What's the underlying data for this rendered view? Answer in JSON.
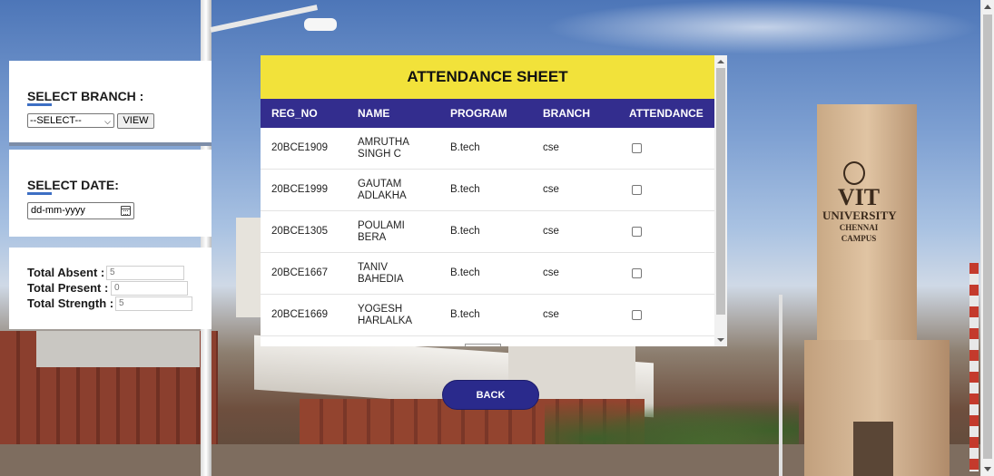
{
  "branch": {
    "heading_prefix": "SEL",
    "heading_rest": "ECT BRANCH :",
    "select_value": "--SELECT--",
    "view_label": "VIEW"
  },
  "date": {
    "heading_prefix": "SEL",
    "heading_rest": "ECT DATE:",
    "placeholder": "dd-mm-yyyy"
  },
  "totals": {
    "absent_label": "Total Absent :",
    "absent_value": "5",
    "present_label": "Total Present :",
    "present_value": "0",
    "strength_label": "Total Strength :",
    "strength_value": "5"
  },
  "sheet": {
    "title": "ATTENDANCE SHEET",
    "columns": [
      "REG_NO",
      "NAME",
      "PROGRAM",
      "BRANCH",
      "ATTENDANCE"
    ],
    "rows": [
      {
        "reg_no": "20BCE1909",
        "name_line1": "AMRUTHA",
        "name_line2": "SINGH C",
        "program": "B.tech",
        "branch": "cse"
      },
      {
        "reg_no": "20BCE1999",
        "name_line1": "GAUTAM",
        "name_line2": "ADLAKHA",
        "program": "B.tech",
        "branch": "cse"
      },
      {
        "reg_no": "20BCE1305",
        "name_line1": "POULAMI",
        "name_line2": "BERA",
        "program": "B.tech",
        "branch": "cse"
      },
      {
        "reg_no": "20BCE1667",
        "name_line1": "TANIV",
        "name_line2": "BAHEDIA",
        "program": "B.tech",
        "branch": "cse"
      },
      {
        "reg_no": "20BCE1669",
        "name_line1": "YOGESH",
        "name_line2": "HARLALKA",
        "program": "B.tech",
        "branch": "cse"
      }
    ]
  },
  "back_label": "BACK",
  "background": {
    "tower_line1": "VIT",
    "tower_line2": "UNIVERSITY",
    "tower_line3": "CHENNAI CAMPUS"
  },
  "colors": {
    "sheet_title_bg": "#f2e23a",
    "sheet_header_bg": "#332d8e",
    "back_button_bg": "#2a2a8c",
    "heading_underline": "#3d6fc4"
  },
  "icons": {
    "calendar": "calendar-icon",
    "select_chevron": "chevron-down-icon"
  }
}
